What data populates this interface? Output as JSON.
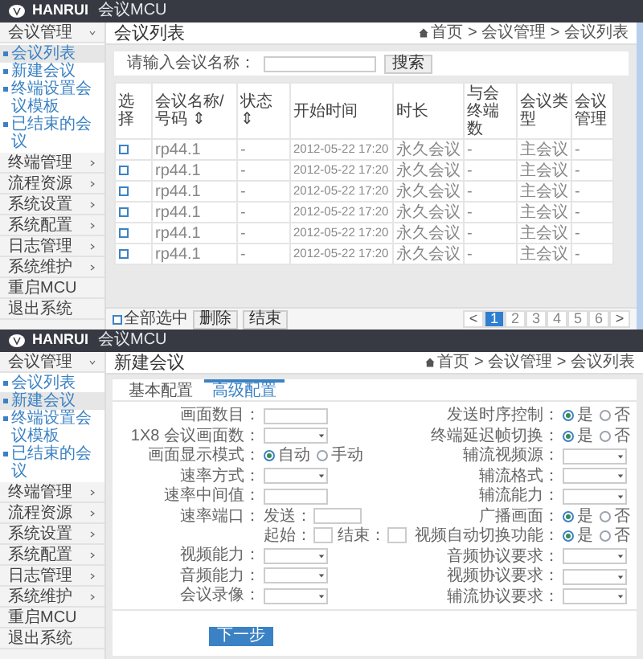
{
  "screens": [
    {
      "kind": "list",
      "brand": "HANRUI",
      "product": "会议MCU",
      "title": "会议列表",
      "breadcrumb": "首页 > 会议管理 > 会议列表",
      "sidebar": [
        {
          "kind": "menu",
          "label": "会议管理",
          "expanded": true,
          "children": [
            {
              "label": "会议列表",
              "selected": true
            },
            {
              "label": "新建会议",
              "selected": false
            },
            {
              "label": "终端设置会议模板",
              "selected": false
            },
            {
              "label": "已结束的会议",
              "selected": false
            }
          ]
        },
        {
          "kind": "menu",
          "label": "终端管理",
          "expanded": false
        },
        {
          "kind": "menu",
          "label": "流程资源",
          "expanded": false
        },
        {
          "kind": "menu",
          "label": "系统设置",
          "expanded": false
        },
        {
          "kind": "menu",
          "label": "系统配置",
          "expanded": false
        },
        {
          "kind": "menu",
          "label": "日志管理",
          "expanded": false
        },
        {
          "kind": "menu",
          "label": "系统维护",
          "expanded": false
        },
        {
          "kind": "action",
          "label": "重启MCU"
        },
        {
          "kind": "action",
          "label": "退出系统"
        }
      ],
      "search": {
        "label": "请输入会议名称：",
        "button": "搜索"
      },
      "table": {
        "columns": [
          "选择",
          "会议名称/号码 ⇕",
          "状态 ⇕",
          "开始时间",
          "时长",
          "与会终端数",
          "会议类型",
          "会议管理"
        ],
        "rows": [
          {
            "cells": [
              {
                "checked": false
              },
              "rp44.1",
              "-",
              "2012-05-22 17:20",
              "永久会议",
              "-",
              "主会议",
              "-"
            ]
          },
          {
            "cells": [
              {
                "checked": false
              },
              "rp44.1",
              "-",
              "2012-05-22 17:20",
              "永久会议",
              "-",
              "主会议",
              "-"
            ]
          },
          {
            "cells": [
              {
                "checked": false
              },
              "rp44.1",
              "-",
              "2012-05-22 17:20",
              "永久会议",
              "-",
              "主会议",
              "-"
            ]
          },
          {
            "cells": [
              {
                "checked": false
              },
              "rp44.1",
              "-",
              "2012-05-22 17:20",
              "永久会议",
              "-",
              "主会议",
              "-"
            ]
          },
          {
            "cells": [
              {
                "checked": false
              },
              "rp44.1",
              "-",
              "2012-05-22 17:20",
              "永久会议",
              "-",
              "主会议",
              "-"
            ]
          },
          {
            "cells": [
              {
                "checked": false
              },
              "rp44.1",
              "-",
              "2012-05-22 17:20",
              "永久会议",
              "-",
              "主会议",
              "-"
            ]
          }
        ]
      },
      "footer": {
        "select_all": {
          "label": "全部选中",
          "checked": false
        },
        "buttons": [
          "删除",
          "结束"
        ]
      },
      "pagination": {
        "prev": "<",
        "next": ">",
        "pages": [
          {
            "label": "1",
            "selected": true
          },
          {
            "label": "2",
            "selected": false
          },
          {
            "label": "3",
            "selected": false
          },
          {
            "label": "4",
            "selected": false
          },
          {
            "label": "5",
            "selected": false
          },
          {
            "label": "6",
            "selected": false
          }
        ]
      }
    },
    {
      "kind": "form",
      "brand": "HANRUI",
      "product": "会议MCU",
      "title": "新建会议",
      "breadcrumb": "首页 > 会议管理 > 会议列表",
      "sidebar": [
        {
          "kind": "menu",
          "label": "会议管理",
          "expanded": true,
          "children": [
            {
              "label": "会议列表",
              "selected": false
            },
            {
              "label": "新建会议",
              "selected": true
            },
            {
              "label": "终端设置会议模板",
              "selected": false
            },
            {
              "label": "已结束的会议",
              "selected": false
            }
          ]
        },
        {
          "kind": "menu",
          "label": "终端管理",
          "expanded": false
        },
        {
          "kind": "menu",
          "label": "流程资源",
          "expanded": false
        },
        {
          "kind": "menu",
          "label": "系统设置",
          "expanded": false
        },
        {
          "kind": "menu",
          "label": "系统配置",
          "expanded": false
        },
        {
          "kind": "menu",
          "label": "日志管理",
          "expanded": false
        },
        {
          "kind": "menu",
          "label": "系统维护",
          "expanded": false
        },
        {
          "kind": "action",
          "label": "重启MCU"
        },
        {
          "kind": "action",
          "label": "退出系统"
        }
      ],
      "tabs": [
        {
          "label": "基本配置",
          "selected": false
        },
        {
          "label": "高级配置",
          "selected": true
        }
      ],
      "left_fields": [
        {
          "kind": "input",
          "label": "画面数目："
        },
        {
          "kind": "select",
          "label": "1X8 会议画面数："
        },
        {
          "kind": "radio",
          "label": "画面显示模式：",
          "options": [
            {
              "label": "自动",
              "selected": true
            },
            {
              "label": "手动",
              "selected": false
            }
          ]
        },
        {
          "kind": "select",
          "label": "速率方式："
        },
        {
          "kind": "input",
          "label": "速率中间值："
        },
        {
          "kind": "port",
          "label": "速率端口：",
          "parts": [
            "发送：",
            "起始：",
            "结束："
          ]
        },
        {
          "kind": "select",
          "label": "视频能力："
        },
        {
          "kind": "select",
          "label": "音频能力："
        },
        {
          "kind": "select",
          "label": "会议录像："
        }
      ],
      "right_fields": [
        {
          "kind": "radio",
          "label": "发送时序控制：",
          "options": [
            {
              "label": "是",
              "selected": true
            },
            {
              "label": "否",
              "selected": false
            }
          ]
        },
        {
          "kind": "radio",
          "label": "终端延迟帧切换：",
          "options": [
            {
              "label": "是",
              "selected": true
            },
            {
              "label": "否",
              "selected": false
            }
          ]
        },
        {
          "kind": "select",
          "label": "辅流视频源："
        },
        {
          "kind": "select",
          "label": "辅流格式："
        },
        {
          "kind": "select",
          "label": "辅流能力："
        },
        {
          "kind": "radio",
          "label": "广播画面：",
          "options": [
            {
              "label": "是",
              "selected": true
            },
            {
              "label": "否",
              "selected": false
            }
          ]
        },
        {
          "kind": "radio",
          "label": "视频自动切换功能：",
          "options": [
            {
              "label": "是",
              "selected": true
            },
            {
              "label": "否",
              "selected": false
            }
          ]
        },
        {
          "kind": "select",
          "label": "音频协议要求："
        },
        {
          "kind": "select",
          "label": "视频协议要求："
        },
        {
          "kind": "select",
          "label": "辅流协议要求："
        }
      ],
      "next_button": "下一步"
    }
  ]
}
